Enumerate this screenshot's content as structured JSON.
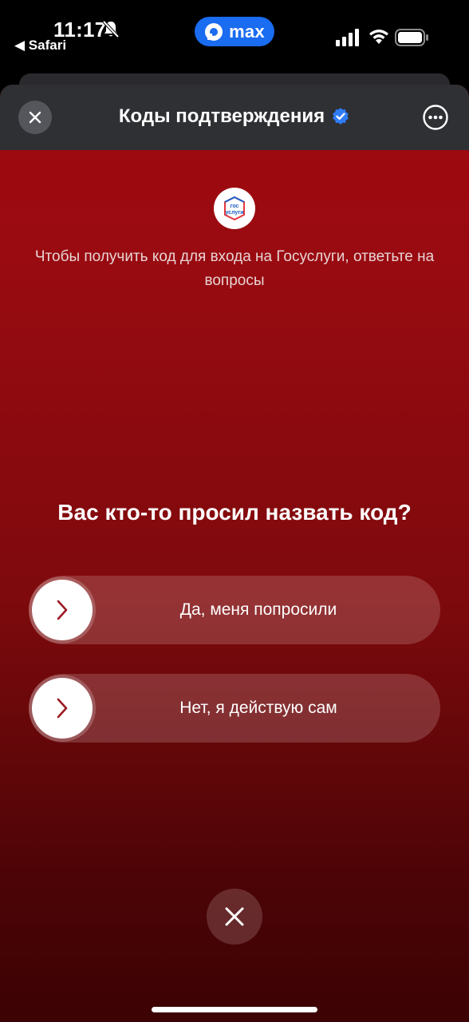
{
  "status_bar": {
    "time": "11:17",
    "back_app": "◀ Safari",
    "pill_label": "max",
    "icons": [
      "bell-slash-icon",
      "max-logo-icon",
      "signal-icon",
      "wifi-icon",
      "battery-icon"
    ],
    "pill_color": "#1a6cf0"
  },
  "nav": {
    "title": "Коды подтверждения",
    "icons": [
      "close-icon",
      "verified-badge-icon",
      "more-options-icon"
    ],
    "verified_color": "#2f7cf6"
  },
  "content": {
    "logo_text_top": "гос",
    "logo_text_bottom": "услуги",
    "subtitle": "Чтобы получить код для входа на Госуслуги, ответьте на вопросы",
    "question": "Вас кто-то просил назвать код?",
    "answers": [
      {
        "label": "Да, меня попросили",
        "icon": "chevron-right-icon"
      },
      {
        "label": "Нет, я действую сам",
        "icon": "chevron-right-icon"
      }
    ],
    "dismiss_icon": "close-icon"
  },
  "colors": {
    "accent_red": "#9d0a10",
    "chevron": "#9b1b22"
  }
}
